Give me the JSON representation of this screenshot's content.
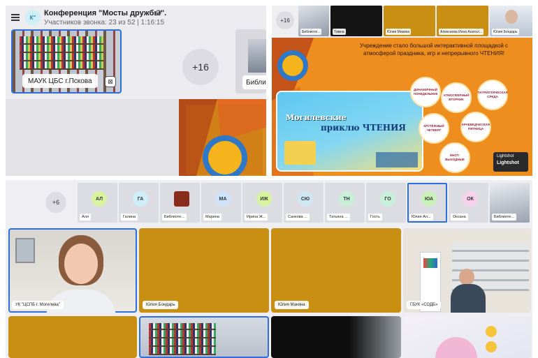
{
  "conference": {
    "avatar_initial": "К\"",
    "title": "Конференция \"Мосты дружбы\".",
    "subtitle": "Участников звонка: 23 из 52 | 1:16:15",
    "settings_icon": "gear-icon"
  },
  "left_panel": {
    "tile_main_label": "МАУК ЦБС г.Пскова",
    "more_count": "+16",
    "tile_side_label": "Библис"
  },
  "right_panel": {
    "more_count": "+16",
    "participants": [
      {
        "name": "Библиоте..."
      },
      {
        "name": "Тимна"
      },
      {
        "name": "Юлия Макина"
      },
      {
        "name": "Алексеева Инна Анатол..."
      },
      {
        "name": "Юлия Бондарь"
      }
    ],
    "slide": {
      "headline": "Учреждение стало большой интерактивной площадкой с атмосферой праздника, игр и непрерывного ЧТЕНИЯ!",
      "banner_line1": "Могилевские",
      "banner_line2": "приклю ЧТЕНИЯ",
      "circles": [
        "ДИНАМИЧНЫЙ ПОНЕДЕЛЬНИК",
        "АТМОСФЕРНЫЙ ВТОРНИК",
        "ПАТРИОТИЧЕСКАЯ СРЕДА",
        "КРУТЁЖНЫЙ ЧЕТВЕРГ",
        "КРАЕВЕДЧЕСКАЯ ПЯТНИЦА",
        "ИНОТ- ВЫХОДНЫЕ"
      ]
    },
    "lightshot_label": "Lightshot",
    "lightshot_title": "Lightshot"
  },
  "bottom_panel": {
    "more_count": "+6",
    "mini_tiles": [
      {
        "initials": "АЛ",
        "name": "Аля",
        "color": "#d7f3a0"
      },
      {
        "initials": "ГА",
        "name": "Галина",
        "color": "#cfeef8"
      },
      {
        "initials": "",
        "name": "Библиоте...",
        "color": "#8a2c1c"
      },
      {
        "initials": "МА",
        "name": "Марина",
        "color": "#cfe3fa"
      },
      {
        "initials": "ИЖ",
        "name": "Ирина Ж...",
        "color": "#d7f3a0"
      },
      {
        "initials": "СЮ",
        "name": "Санкова ...",
        "color": "#cfe7f3"
      },
      {
        "initials": "ТН",
        "name": "Татьяна ...",
        "color": "#c8f0d8"
      },
      {
        "initials": "ГО",
        "name": "Гость",
        "color": "#c8f0d8"
      },
      {
        "initials": "ЮА",
        "name": "Юлия Ал...",
        "color": "#c8f0b8"
      },
      {
        "initials": "ОК",
        "name": "Оксана",
        "color": "#f8d2ec"
      },
      {
        "initials": "",
        "name": "Библиоте...",
        "color": "#9aa0aa"
      }
    ],
    "video_tiles": [
      {
        "name": "УК \"ЦСПБ г. Могилева\""
      },
      {
        "name": "Юлия Бондарь"
      },
      {
        "name": "Юлия Макина"
      },
      {
        "name": "ГБУК «СОДБ»"
      }
    ]
  },
  "colors": {
    "accent": "#2d6fe0",
    "orange_tile": "#c88f12",
    "slide_orange": "#ee8e1e"
  }
}
